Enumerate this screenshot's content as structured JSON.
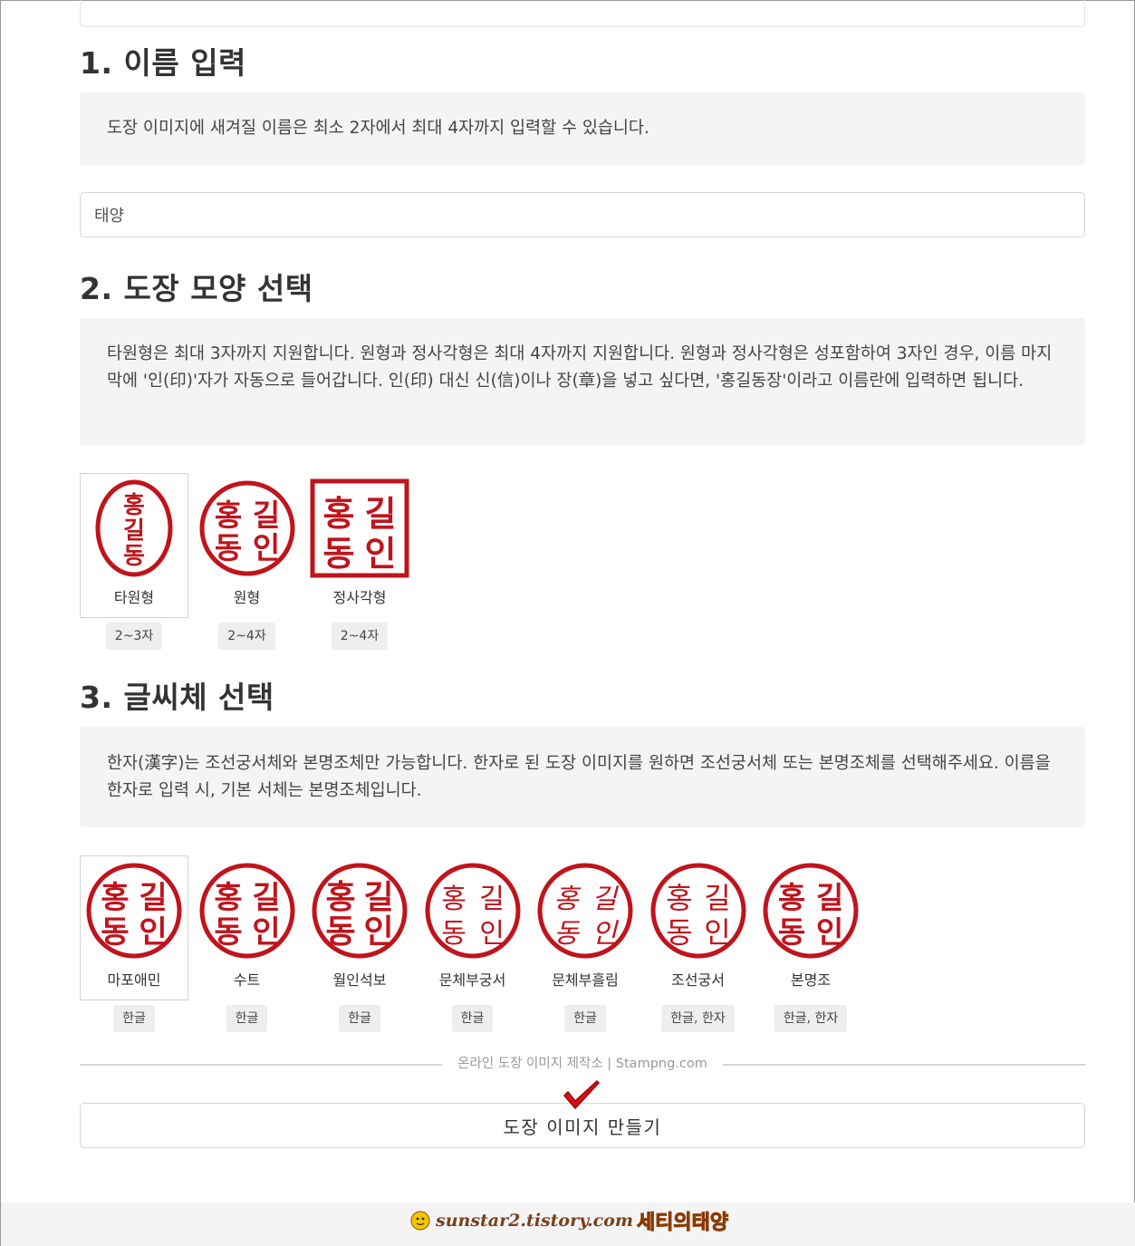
{
  "section1": {
    "title": "1. 이름 입력",
    "note": "도장 이미지에 새겨질 이름은 최소 2자에서 최대 4자까지 입력할 수 있습니다.",
    "input_value": "태양"
  },
  "section2": {
    "title": "2. 도장 모양 선택",
    "note": "타원형은 최대 3자까지 지원합니다. 원형과 정사각형은 최대 4자까지 지원합니다. 원형과 정사각형은 성포함하여 3자인 경우, 이름 마지막에 '인(印)'자가 자동으로 들어갑니다. 인(印) 대신 신(信)이나 장(章)을 넣고 싶다면, '홍길동장'이라고 이름란에 입력하면 됩니다.",
    "shapes": [
      {
        "label": "타원형",
        "badge": "2~3자",
        "glyphs": [
          "홍",
          "길",
          "동"
        ]
      },
      {
        "label": "원형",
        "badge": "2~4자",
        "glyphs": [
          "홍",
          "길",
          "동",
          "인"
        ]
      },
      {
        "label": "정사각형",
        "badge": "2~4자",
        "glyphs": [
          "홍",
          "길",
          "동",
          "인"
        ]
      }
    ]
  },
  "section3": {
    "title": "3. 글씨체 선택",
    "note": "한자(漢字)는 조선궁서체와 본명조체만 가능합니다. 한자로 된 도장 이미지를 원하면 조선궁서체 또는 본명조체를 선택해주세요. 이름을 한자로 입력 시, 기본 서체는 본명조체입니다.",
    "fonts": [
      {
        "label": "마포애민",
        "badge": "한글",
        "glyphs": [
          "홍",
          "길",
          "동",
          "인"
        ]
      },
      {
        "label": "수트",
        "badge": "한글",
        "glyphs": [
          "홍",
          "길",
          "동",
          "인"
        ]
      },
      {
        "label": "월인석보",
        "badge": "한글",
        "glyphs": [
          "홍",
          "길",
          "동",
          "인"
        ]
      },
      {
        "label": "문체부궁서",
        "badge": "한글",
        "glyphs": [
          "홍",
          "길",
          "동",
          "인"
        ]
      },
      {
        "label": "문체부흘림",
        "badge": "한글",
        "glyphs": [
          "홍",
          "길",
          "동",
          "인"
        ]
      },
      {
        "label": "조선궁서",
        "badge": "한글, 한자",
        "glyphs": [
          "홍",
          "길",
          "동",
          "인"
        ]
      },
      {
        "label": "본명조",
        "badge": "한글, 한자",
        "glyphs": [
          "홍",
          "길",
          "동",
          "인"
        ]
      }
    ]
  },
  "separator_text": "온라인 도장 이미지 제작소 | Stampng.com",
  "make_button": "도장 이미지 만들기",
  "watermark": {
    "site": "sunstar2.tistory.com",
    "brand": "세티의태양"
  },
  "colors": {
    "stamp_red": "#c0141c",
    "note_bg": "#f4f4f4",
    "check_red": "#d11"
  }
}
